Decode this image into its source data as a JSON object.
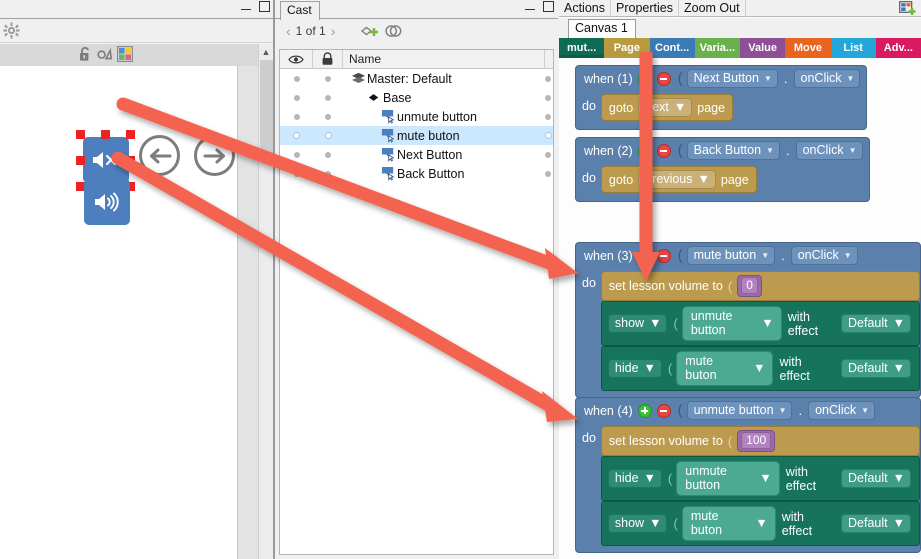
{
  "app": {
    "stage_panel": {
      "title": "",
      "gear_icon": "gear-icon"
    },
    "cast_panel": {
      "tab_label": "Cast",
      "pager": {
        "prev_icon": "chevron-left-icon",
        "label": "1 of 1",
        "next_icon": "chevron-right-icon"
      },
      "tool_icons": [
        "add-sprite-icon",
        "duplicate-icon"
      ],
      "columns": [
        "",
        "",
        "Name"
      ],
      "column_icons": [
        "eye-icon",
        "lock-icon"
      ],
      "rows": [
        {
          "name": "Master: Default",
          "indent": 0,
          "icon": "layers-icon",
          "selected": false
        },
        {
          "name": "Base",
          "indent": 1,
          "icon": "diamond-icon",
          "selected": false
        },
        {
          "name": "unmute button",
          "indent": 2,
          "icon": "button-object-icon",
          "selected": false
        },
        {
          "name": "mute buton",
          "indent": 2,
          "icon": "button-object-icon",
          "selected": true
        },
        {
          "name": "Next Button",
          "indent": 2,
          "icon": "button-object-icon",
          "selected": false
        },
        {
          "name": "Back Button",
          "indent": 2,
          "icon": "button-object-icon",
          "selected": false
        }
      ]
    },
    "stage": {
      "toolbar_icons": [
        "unlock-icon",
        "shape-icon",
        "palette-icon"
      ],
      "objects": [
        {
          "name": "mute-button-sprite",
          "icon": "speaker-mute-icon",
          "selected": true
        },
        {
          "name": "unmute-button-sprite",
          "icon": "speaker-volume-icon",
          "selected": false
        },
        {
          "name": "back-button-sprite",
          "icon": "arrow-left-circle-icon",
          "selected": false
        },
        {
          "name": "next-button-sprite",
          "icon": "arrow-right-circle-icon",
          "selected": false
        }
      ]
    },
    "actions_panel": {
      "menu": [
        "Actions",
        "Properties",
        "Zoom Out"
      ],
      "corner_icon": "add-window-icon",
      "canvas_tabs": [
        {
          "label": "Canvas 1",
          "active": true
        }
      ],
      "palette": [
        {
          "label": "mut...",
          "color": "#0f6b53",
          "selected": true
        },
        {
          "label": "Page",
          "color": "#b79b3e",
          "selected": false
        },
        {
          "label": "Cont...",
          "color": "#3b7bb5",
          "selected": false
        },
        {
          "label": "Varia...",
          "color": "#6ab04c",
          "selected": false
        },
        {
          "label": "Value",
          "color": "#8e4f96",
          "selected": false
        },
        {
          "label": "Move",
          "color": "#e8651f",
          "selected": false
        },
        {
          "label": "List",
          "color": "#22a7d8",
          "selected": false
        },
        {
          "label": "Adv...",
          "color": "#d81b60",
          "selected": false
        }
      ],
      "do_word": "do",
      "with_effect_label": "with effect",
      "blocks": [
        {
          "when_label": "when (1)",
          "has_plus": true,
          "has_minus": true,
          "target": "Next Button",
          "event": "onClick",
          "body": [
            {
              "kind": "goto-page",
              "prefix": "goto",
              "value": "next",
              "suffix": "page"
            }
          ]
        },
        {
          "when_label": "when (2)",
          "has_plus": true,
          "has_minus": true,
          "target": "Back Button",
          "event": "onClick",
          "body": [
            {
              "kind": "goto-page",
              "prefix": "goto",
              "value": "previous",
              "suffix": "page"
            }
          ]
        },
        {
          "when_label": "when (3)",
          "has_plus": true,
          "has_minus": true,
          "target": "mute buton",
          "event": "onClick",
          "body": [
            {
              "kind": "set-volume",
              "label": "set lesson volume to",
              "value": "0"
            },
            {
              "kind": "show-hide",
              "action": "show",
              "target": "unmute button",
              "effect": "Default"
            },
            {
              "kind": "show-hide",
              "action": "hide",
              "target": "mute buton",
              "effect": "Default"
            }
          ]
        },
        {
          "when_label": "when (4)",
          "has_plus": true,
          "has_minus": true,
          "target": "unmute button",
          "event": "onClick",
          "body": [
            {
              "kind": "set-volume",
              "label": "set lesson volume to",
              "value": "100"
            },
            {
              "kind": "show-hide",
              "action": "hide",
              "target": "unmute button",
              "effect": "Default"
            },
            {
              "kind": "show-hide",
              "action": "show",
              "target": "mute buton",
              "effect": "Default"
            }
          ]
        }
      ]
    },
    "annotations": {
      "color": "#f4634f",
      "arrows": [
        {
          "name": "arrow-to-block-3",
          "from": "mute-button-sprite",
          "to": "when-3-block"
        },
        {
          "name": "arrow-to-block-4",
          "from": "unmute-button-sprite",
          "to": "when-4-block"
        },
        {
          "name": "arrow-down-to-mute-block",
          "from": "palette-page",
          "to": "when-3-target"
        }
      ]
    }
  }
}
